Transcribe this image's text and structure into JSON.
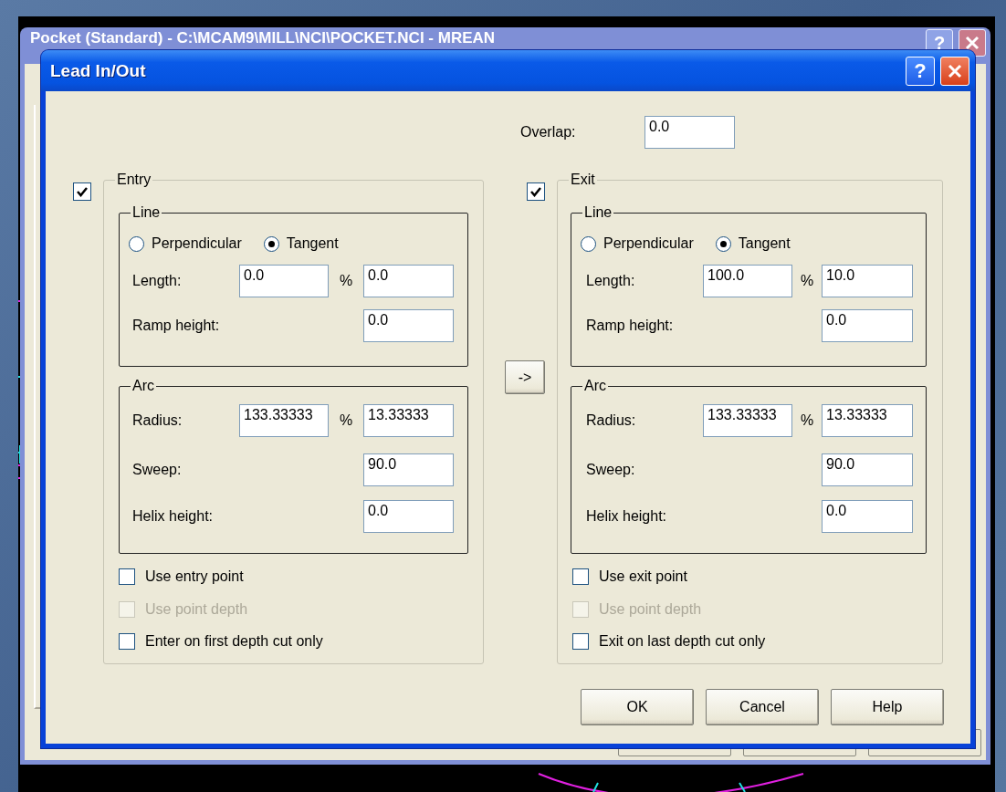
{
  "background_window": {
    "title": "Pocket (Standard) - C:\\MCAM9\\MILL\\NCI\\POCKET.NCI - MREAN",
    "help_button": "?"
  },
  "dialog": {
    "title": "Lead In/Out",
    "help_button": "?"
  },
  "overlap": {
    "label": "Overlap:",
    "value": "0.0"
  },
  "sections": [
    {
      "title": "Entry",
      "checked": true,
      "line": {
        "title": "Line",
        "options": [
          {
            "label": "Perpendicular",
            "selected": false
          },
          {
            "label": "Tangent",
            "selected": true
          }
        ],
        "fields": [
          {
            "kind": "pair",
            "label": "Length:",
            "value": "0.0",
            "unit": "%",
            "second_value": "0.0"
          },
          {
            "kind": "single",
            "label": "Ramp height:",
            "value": "0.0"
          }
        ]
      },
      "arc": {
        "title": "Arc",
        "fields": [
          {
            "kind": "pair",
            "label": "Radius:",
            "value": "133.33333",
            "unit": "%",
            "second_value": "13.33333"
          },
          {
            "kind": "single",
            "label": "Sweep:",
            "value": "90.0"
          },
          {
            "kind": "single",
            "label": "Helix height:",
            "value": "0.0"
          }
        ]
      },
      "options": [
        {
          "label": "Use entry point",
          "checked": false,
          "disabled": false
        },
        {
          "label": "Use point depth",
          "checked": false,
          "disabled": true
        },
        {
          "label": "Enter on first depth cut only",
          "checked": false,
          "disabled": false
        }
      ]
    },
    {
      "title": "Exit",
      "checked": true,
      "line": {
        "title": "Line",
        "options": [
          {
            "label": "Perpendicular",
            "selected": false
          },
          {
            "label": "Tangent",
            "selected": true
          }
        ],
        "fields": [
          {
            "kind": "pair",
            "label": "Length:",
            "value": "100.0",
            "unit": "%",
            "second_value": "10.0"
          },
          {
            "kind": "single",
            "label": "Ramp height:",
            "value": "0.0"
          }
        ]
      },
      "arc": {
        "title": "Arc",
        "fields": [
          {
            "kind": "pair",
            "label": "Radius:",
            "value": "133.33333",
            "unit": "%",
            "second_value": "13.33333"
          },
          {
            "kind": "single",
            "label": "Sweep:",
            "value": "90.0"
          },
          {
            "kind": "single",
            "label": "Helix height:",
            "value": "0.0"
          }
        ]
      },
      "options": [
        {
          "label": "Use exit point",
          "checked": false,
          "disabled": false
        },
        {
          "label": "Use point depth",
          "checked": false,
          "disabled": true
        },
        {
          "label": "Exit on last depth cut only",
          "checked": false,
          "disabled": false
        }
      ]
    }
  ],
  "copy_button": "->",
  "buttons": [
    "OK",
    "Cancel",
    "Help"
  ]
}
